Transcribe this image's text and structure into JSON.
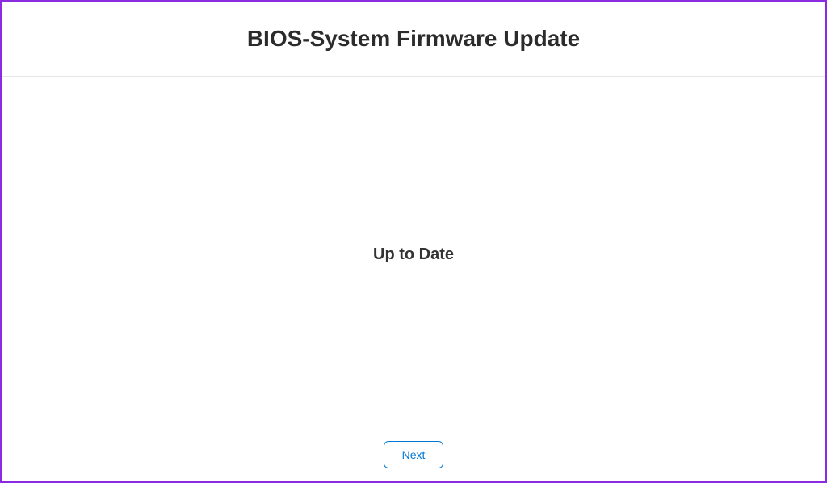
{
  "header": {
    "title": "BIOS-System Firmware Update"
  },
  "main": {
    "status": "Up to Date"
  },
  "footer": {
    "next_label": "Next"
  }
}
